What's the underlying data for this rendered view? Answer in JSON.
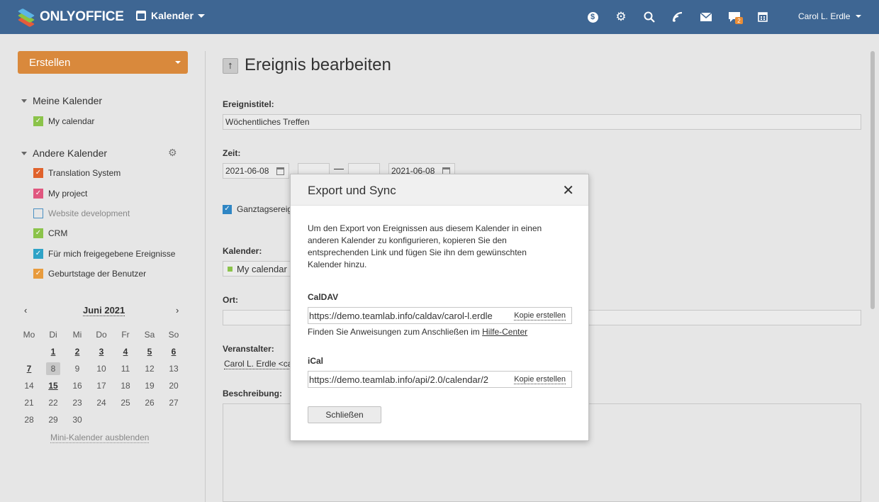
{
  "topbar": {
    "brand": "ONLYOFFICE",
    "module": "Kalender",
    "user_name": "Carol L. Erdle",
    "chat_badge": "2",
    "icons": [
      "billing-icon",
      "settings-icon",
      "search-icon",
      "feed-icon",
      "mail-icon",
      "chat-icon",
      "calendar-icon"
    ]
  },
  "sidebar": {
    "create_label": "Erstellen",
    "my_calendars_title": "Meine Kalender",
    "my_calendars": [
      {
        "label": "My calendar",
        "color": "#8bc34a",
        "checked": true
      }
    ],
    "other_calendars_title": "Andere Kalender",
    "other_calendars": [
      {
        "label": "Translation System",
        "color": "#e0622c",
        "checked": true
      },
      {
        "label": "My project",
        "color": "#e0577f",
        "checked": true
      },
      {
        "label": "Website development",
        "color": "#4a90c2",
        "checked": false
      },
      {
        "label": "CRM",
        "color": "#8bc34a",
        "checked": true
      },
      {
        "label": "Für mich freigegebene Ereignisse",
        "color": "#2fa3c7",
        "checked": true
      },
      {
        "label": "Geburtstage der Benutzer",
        "color": "#e89b3d",
        "checked": true
      }
    ],
    "mini_calendar": {
      "prev": "‹",
      "next": "›",
      "month": "Juni 2021",
      "weekdays": [
        "Mo",
        "Di",
        "Mi",
        "Do",
        "Fr",
        "Sa",
        "So"
      ],
      "weeks": [
        [
          "",
          "1",
          "2",
          "3",
          "4",
          "5",
          "6"
        ],
        [
          "7",
          "8",
          "9",
          "10",
          "11",
          "12",
          "13"
        ],
        [
          "14",
          "15",
          "16",
          "17",
          "18",
          "19",
          "20"
        ],
        [
          "21",
          "22",
          "23",
          "24",
          "25",
          "26",
          "27"
        ],
        [
          "28",
          "29",
          "30",
          "",
          "",
          "",
          ""
        ]
      ],
      "event_days": [
        "1",
        "2",
        "3",
        "4",
        "5",
        "6",
        "7",
        "15"
      ],
      "today": "8",
      "hide_label": "Mini-Kalender ausblenden"
    }
  },
  "main": {
    "title": "Ereignis bearbeiten",
    "event_title_label": "Ereignistitel:",
    "event_title_value": "Wöchentliches Treffen",
    "time_label": "Zeit:",
    "start_date": "2021-06-08",
    "end_date": "2021-06-08",
    "allday_label": "Ganztagsereignis",
    "calendar_label": "Kalender:",
    "calendar_value": "My calendar",
    "location_label": "Ort:",
    "organizer_label": "Veranstalter:",
    "organizer_value": "Carol L. Erdle <carol",
    "description_label": "Beschreibung:"
  },
  "dialog": {
    "title": "Export und Sync",
    "intro": "Um den Export von Ereignissen aus diesem Kalender in einen anderen Kalender zu konfigurieren, kopieren Sie den entsprechenden Link und fügen Sie ihn dem gewünschten Kalender hinzu.",
    "caldav_label": "CalDAV",
    "caldav_url": "https://demo.teamlab.info/caldav/carol-l.erdle",
    "copy_label": "Kopie erstellen",
    "help_prefix": "Finden Sie Anweisungen zum Anschließen im ",
    "help_link": "Hilfe-Center",
    "ical_label": "iCal",
    "ical_url": "https://demo.teamlab.info/api/2.0/calendar/2",
    "close_label": "Schließen"
  },
  "colors": {
    "topbar": "#3e6693",
    "create_button": "#d9893c",
    "badge": "#e98d36"
  }
}
